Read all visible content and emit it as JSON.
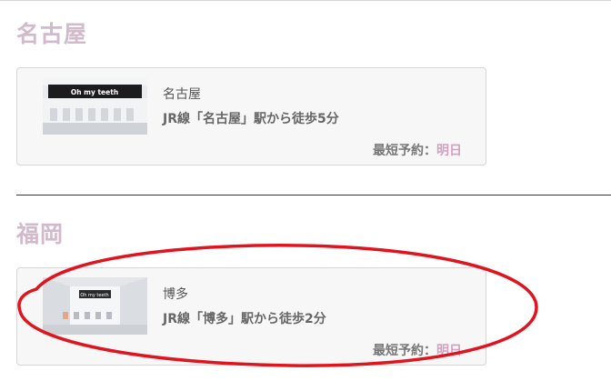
{
  "accent_color": "#d2b9cb",
  "booking_accent_color": "#d4a0c2",
  "annotation_color": "#e0141e",
  "regions": [
    {
      "title": "名古屋",
      "clinic": {
        "name": "名古屋",
        "access": "JR線「名古屋」駅から徒歩5分",
        "booking_label": "最短予約：",
        "booking_value": "明日",
        "photo_sign": "Oh my teeth"
      }
    },
    {
      "title": "福岡",
      "clinic": {
        "name": "博多",
        "access": "JR線「博多」駅から徒歩2分",
        "booking_label": "最短予約：",
        "booking_value": "明日",
        "photo_sign": "Oh my teeth"
      }
    }
  ]
}
